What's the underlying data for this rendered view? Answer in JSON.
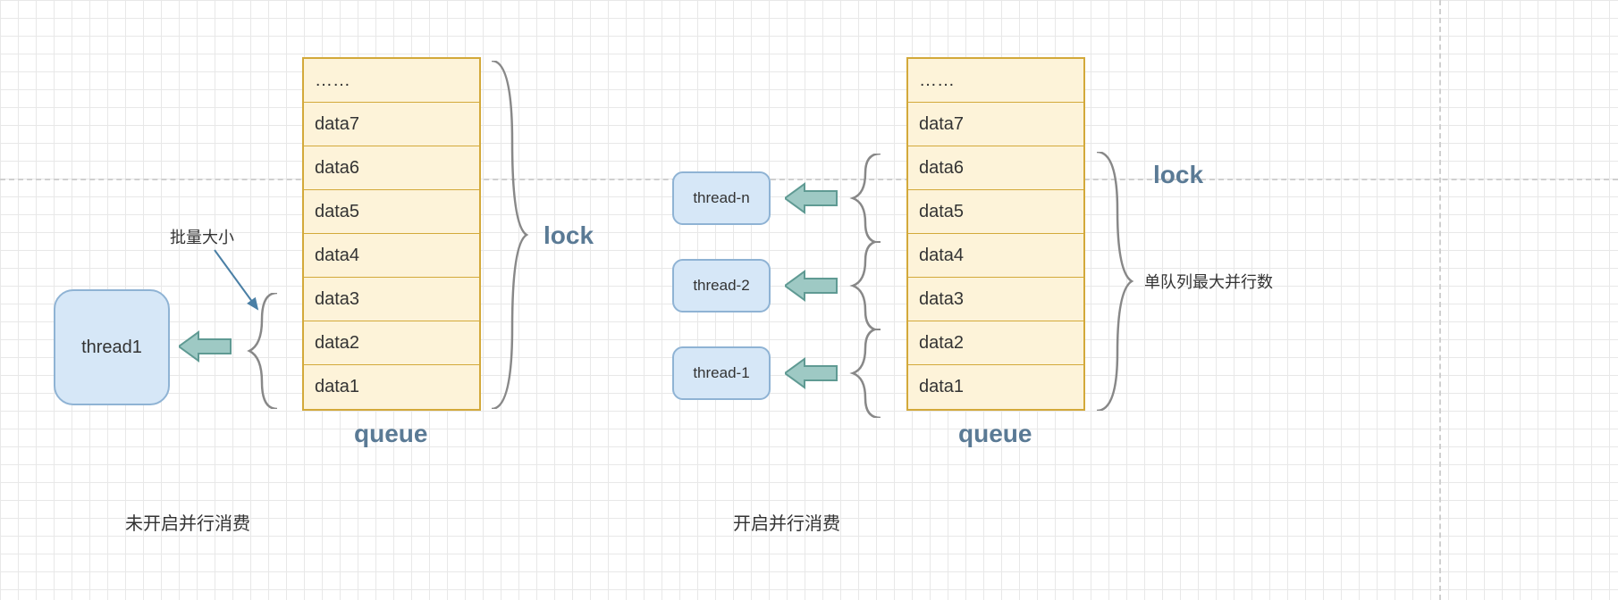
{
  "colors": {
    "thread_fill": "#d6e7f7",
    "thread_stroke": "#8fb3d4",
    "queue_fill": "#fdf3d9",
    "queue_stroke": "#d3a93a",
    "arrow_fill": "#9ec9c4",
    "arrow_stroke": "#5f9a93",
    "text_bold": "#5a7a95"
  },
  "left": {
    "thread_label": "thread1",
    "batch_label": "批量大小",
    "lock_label": "lock",
    "queue_label": "queue",
    "caption": "未开启并行消费",
    "queue": [
      "……",
      "data7",
      "data6",
      "data5",
      "data4",
      "data3",
      "data2",
      "data1"
    ]
  },
  "right": {
    "threads": [
      "thread-n",
      "thread-2",
      "thread-1"
    ],
    "lock_label": "lock",
    "queue_label": "queue",
    "parallel_label": "单队列最大并行数",
    "caption": "开启并行消费",
    "queue": [
      "……",
      "data7",
      "data6",
      "data5",
      "data4",
      "data3",
      "data2",
      "data1"
    ]
  }
}
